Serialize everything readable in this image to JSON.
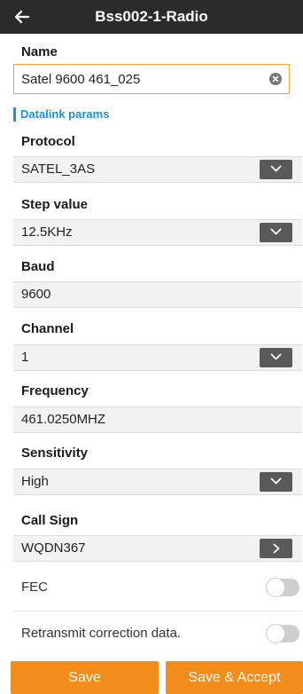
{
  "header": {
    "title": "Bss002-1-Radio"
  },
  "name": {
    "label": "Name",
    "value": "Satel 9600 461_025"
  },
  "section": {
    "title": "Datalink params"
  },
  "protocol": {
    "label": "Protocol",
    "value": "SATEL_3AS"
  },
  "step": {
    "label": "Step value",
    "value": "12.5KHz"
  },
  "baud": {
    "label": "Baud",
    "value": "9600"
  },
  "channel": {
    "label": "Channel",
    "value": "1"
  },
  "frequency": {
    "label": "Frequency",
    "value": "461.0250MHZ"
  },
  "sensitivity": {
    "label": "Sensitivity",
    "value": "High"
  },
  "callsign": {
    "label": "Call Sign",
    "value": "WQDN367"
  },
  "fec": {
    "label": "FEC",
    "enabled": false
  },
  "retransmit": {
    "label": "Retransmit correction data.",
    "enabled": false
  },
  "buttons": {
    "save": "Save",
    "save_accept": "Save & Accept"
  },
  "colors": {
    "accent": "#f28c1a",
    "section": "#1e90d6",
    "header_bg": "#2b2b2b",
    "input_border": "#f0a33b"
  }
}
